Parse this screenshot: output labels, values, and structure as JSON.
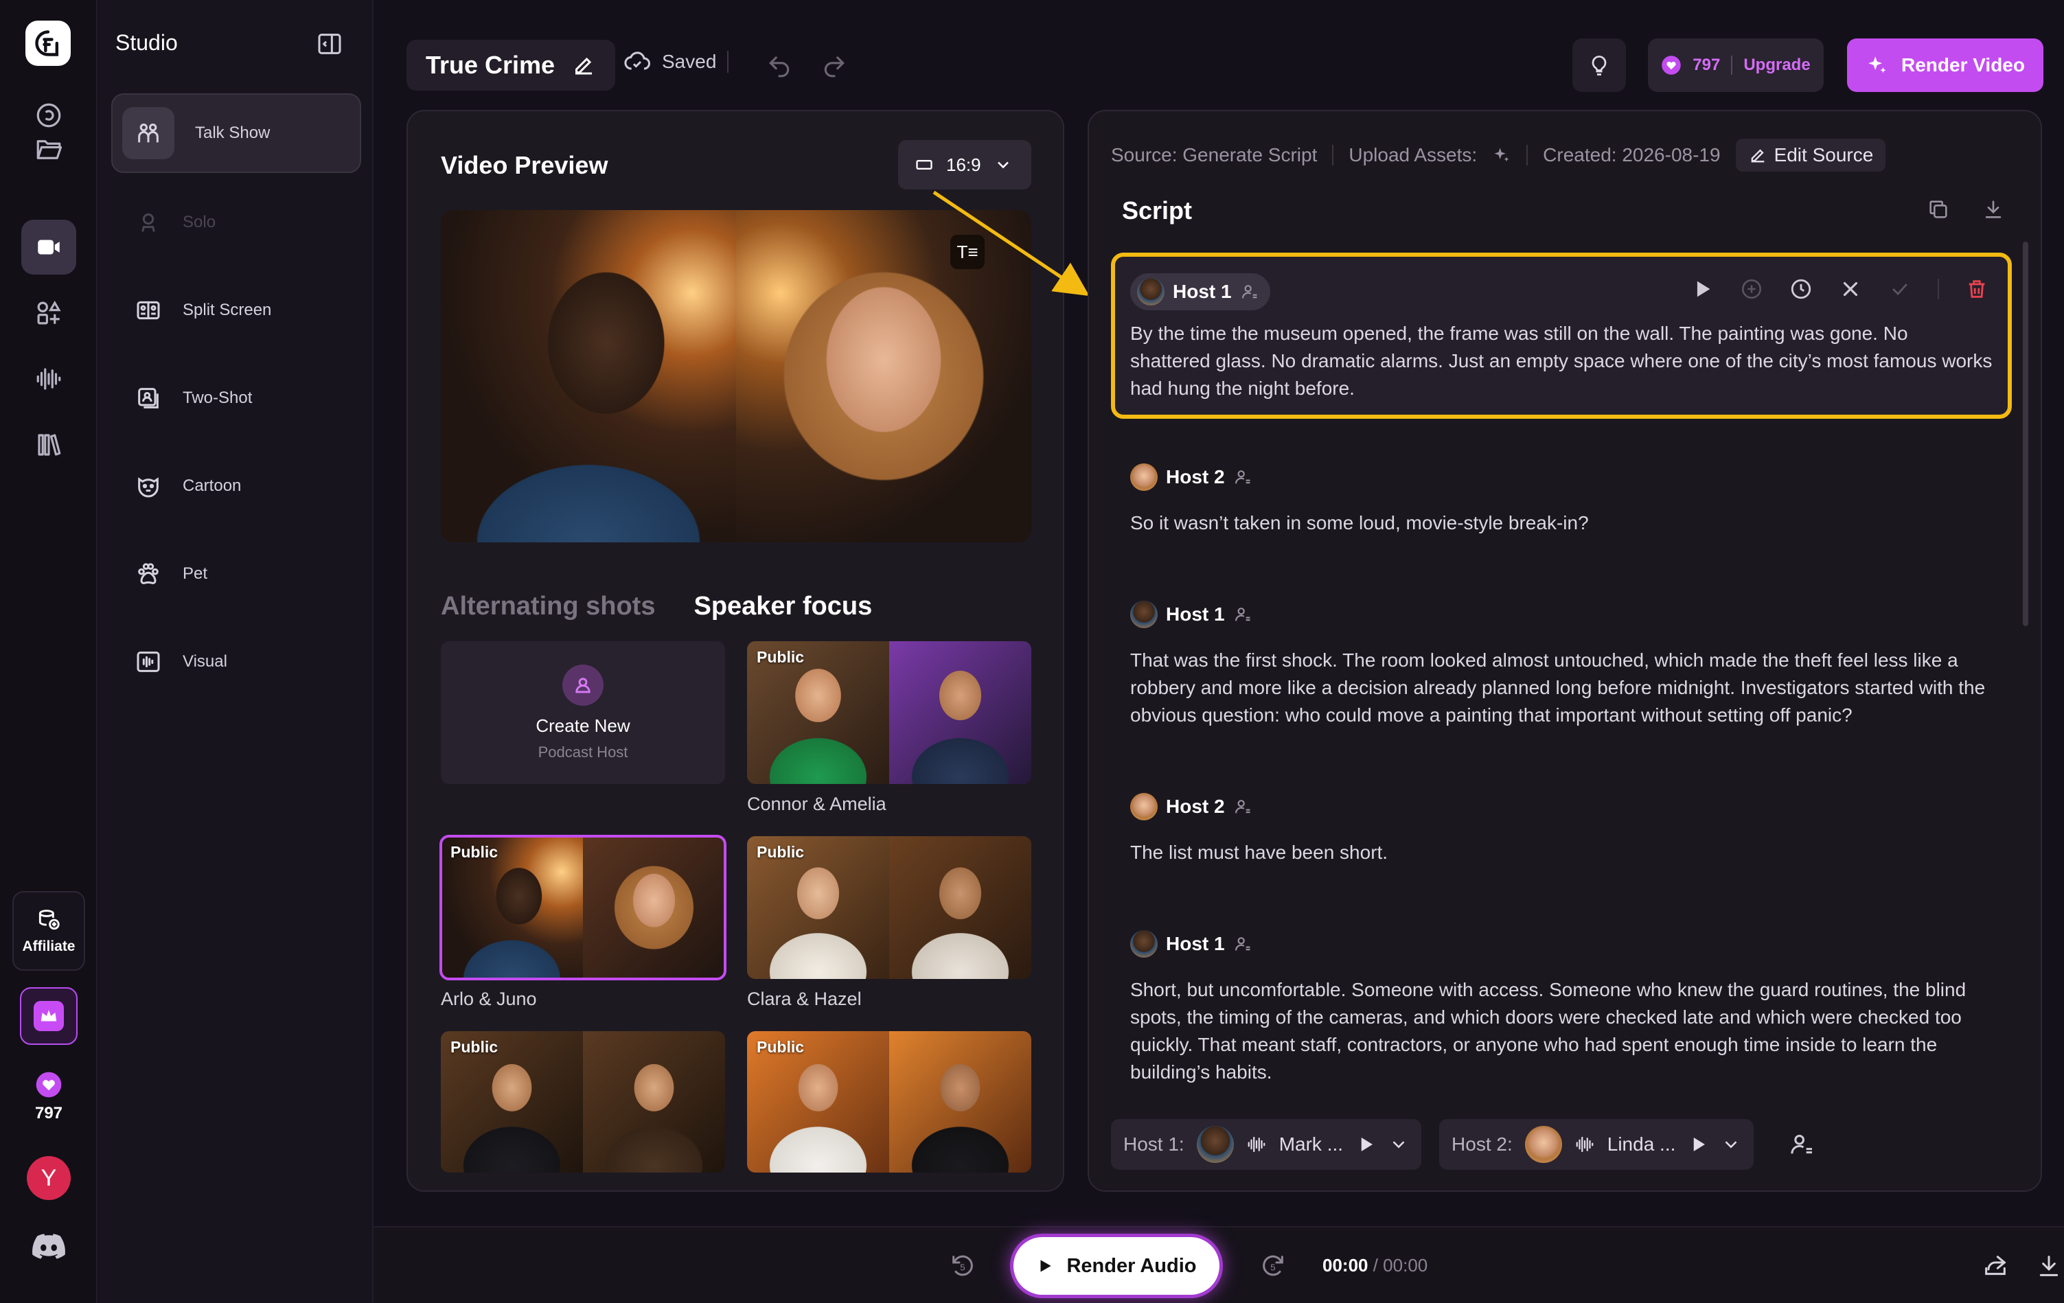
{
  "rail": {
    "affiliate_label": "Affiliate",
    "credits": "797",
    "avatar_letter": "Y"
  },
  "studio": {
    "title": "Studio",
    "modes": [
      {
        "label": "Talk Show",
        "icon": "talk-show-icon",
        "state": "active"
      },
      {
        "label": "Solo",
        "icon": "solo-icon",
        "state": "disabled"
      },
      {
        "label": "Split Screen",
        "icon": "split-screen-icon",
        "state": "normal"
      },
      {
        "label": "Two-Shot",
        "icon": "two-shot-icon",
        "state": "normal"
      },
      {
        "label": "Cartoon",
        "icon": "cartoon-icon",
        "state": "normal"
      },
      {
        "label": "Pet",
        "icon": "paw-icon",
        "state": "normal"
      },
      {
        "label": "Visual",
        "icon": "visual-icon",
        "state": "normal"
      }
    ]
  },
  "topbar": {
    "project_name": "True Crime",
    "saved_label": "Saved",
    "credits": "797",
    "upgrade_label": "Upgrade",
    "render_video_label": "Render Video"
  },
  "preview": {
    "title": "Video Preview",
    "aspect_ratio": "16:9",
    "tab_alternating": "Alternating shots",
    "tab_speaker_focus": "Speaker focus",
    "active_tab": "Speaker focus",
    "create_new_title": "Create New",
    "create_new_subtitle": "Podcast Host",
    "public_badge": "Public",
    "host_pairs": [
      {
        "name": "Connor & Amelia",
        "selected": false
      },
      {
        "name": "Arlo & Juno",
        "selected": true
      },
      {
        "name": "Clara & Hazel",
        "selected": false
      },
      {
        "name": "",
        "selected": false
      },
      {
        "name": "",
        "selected": false
      }
    ]
  },
  "script": {
    "source_label": "Source: Generate Script",
    "upload_label": "Upload Assets:",
    "created_label": "Created: 2026-08-19",
    "edit_source_label": "Edit Source",
    "title": "Script",
    "lines": [
      {
        "speaker": "Host 1",
        "text": "By the time the museum opened, the frame was still on the wall. The painting was gone. No shattered glass. No dramatic alarms. Just an empty space where one of the city’s most famous works had hung the night before.",
        "highlighted": true
      },
      {
        "speaker": "Host 2",
        "text": "So it wasn’t taken in some loud, movie-style break-in?",
        "highlighted": false
      },
      {
        "speaker": "Host 1",
        "text": "That was the first shock. The room looked almost untouched, which made the theft feel less like a robbery and more like a decision already planned long before midnight. Investigators started with the obvious question: who could move a painting that important without setting off panic?",
        "highlighted": false
      },
      {
        "speaker": "Host 2",
        "text": "The list must have been short.",
        "highlighted": false
      },
      {
        "speaker": "Host 1",
        "text": "Short, but uncomfortable. Someone with access. Someone who knew the guard routines, the blind spots, the timing of the cameras, and which doors were checked late and which were checked too quickly. That meant staff, contractors, or anyone who had spent enough time inside to learn the building’s habits.",
        "highlighted": false
      }
    ],
    "voices": [
      {
        "label": "Host 1:",
        "voice": "Mark ..."
      },
      {
        "label": "Host 2:",
        "voice": "Linda ..."
      }
    ]
  },
  "player": {
    "render_audio_label": "Render Audio",
    "current_time": "00:00",
    "total_time": "/ 00:00",
    "skip_back": "5",
    "skip_forward": "5"
  },
  "colors": {
    "accent": "#c34cf0",
    "highlight": "#f3bb12",
    "danger": "#e8434f",
    "background": "#14101a"
  }
}
